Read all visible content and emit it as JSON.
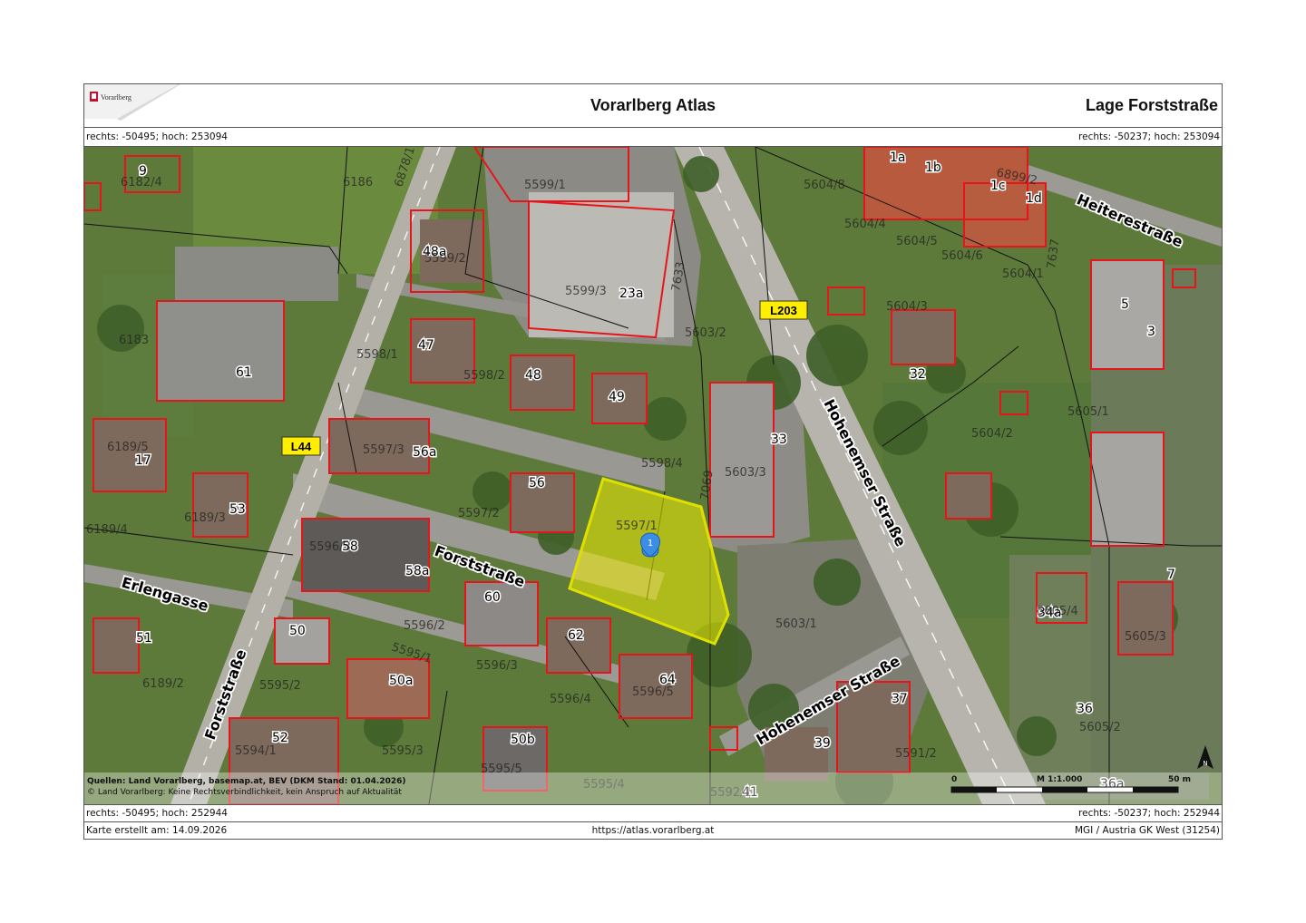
{
  "header": {
    "logo_text": "Vorarlberg",
    "title": "Vorarlberg Atlas",
    "subtitle_right": "Lage Forststraße"
  },
  "coords": {
    "top_left": "rechts: -50495; hoch: 253094",
    "top_right": "rechts: -50237; hoch: 253094",
    "bottom_left": "rechts: -50495; hoch: 252944",
    "bottom_right": "rechts: -50237; hoch: 252944"
  },
  "footer": {
    "created": "Karte erstellt am: 14.09.2026",
    "url": "https://atlas.vorarlberg.at",
    "projection": "MGI / Austria GK West (31254)"
  },
  "map": {
    "sources_line1": "Quellen: Land Vorarlberg, basemap.at, BEV (DKM Stand: 01.04.2026)",
    "sources_line2": "© Land Vorarlberg: Keine Rechtsverbindlichkeit, kein Anspruch auf Aktualität",
    "scale_label": "M 1:1.000",
    "scale_start": "0",
    "scale_end": "50 m",
    "north_label": "N",
    "marker_label": "1",
    "road_tags": [
      "L44",
      "L203"
    ],
    "streets": [
      "Forststraße",
      "Forststraße",
      "Erlengasse",
      "Hohenemser Straße",
      "Hohenemser Straße",
      "Heiterestraße"
    ],
    "house_numbers": [
      "9",
      "48a",
      "23a",
      "47",
      "48",
      "49",
      "61",
      "17",
      "53",
      "56a",
      "56",
      "33",
      "58",
      "58a",
      "60",
      "62",
      "50",
      "51",
      "50a",
      "64",
      "52",
      "50b",
      "39",
      "37",
      "41",
      "36a",
      "1a",
      "1b",
      "1c",
      "1d",
      "5",
      "3",
      "32",
      "7",
      "34a",
      "36"
    ],
    "parcel_numbers": [
      "6182/4",
      "6186",
      "6878/1",
      "5599/1",
      "5599/2",
      "5599/3",
      "7633",
      "5604/8",
      "6899/2",
      "5604/4",
      "5604/5",
      "5604/6",
      "5604/1",
      "7637",
      "5604/3",
      "6183",
      "5603/2",
      "5598/1",
      "5598/2",
      "6189/5",
      "5597/3",
      "5598/4",
      "5603/3",
      "5604/2",
      "5605/1",
      "6189/3",
      "6189/4",
      "5597/2",
      "5597/1",
      "7069",
      "5596/3",
      "5596/2",
      "5603/1",
      "5605/4",
      "5605/3",
      "6189/2",
      "5595/1",
      "5596/3",
      "5596/4",
      "5596/5",
      "5595/2",
      "5595/3",
      "5594/1",
      "5595/5",
      "5595/4",
      "5592/1",
      "5591/2",
      "5605/2"
    ]
  },
  "colors": {
    "parcel_highlight": "#f2f000",
    "building_outline": "#e8141c",
    "road_tag_bg": "#ffee00",
    "marker": "#3b8ee6"
  }
}
